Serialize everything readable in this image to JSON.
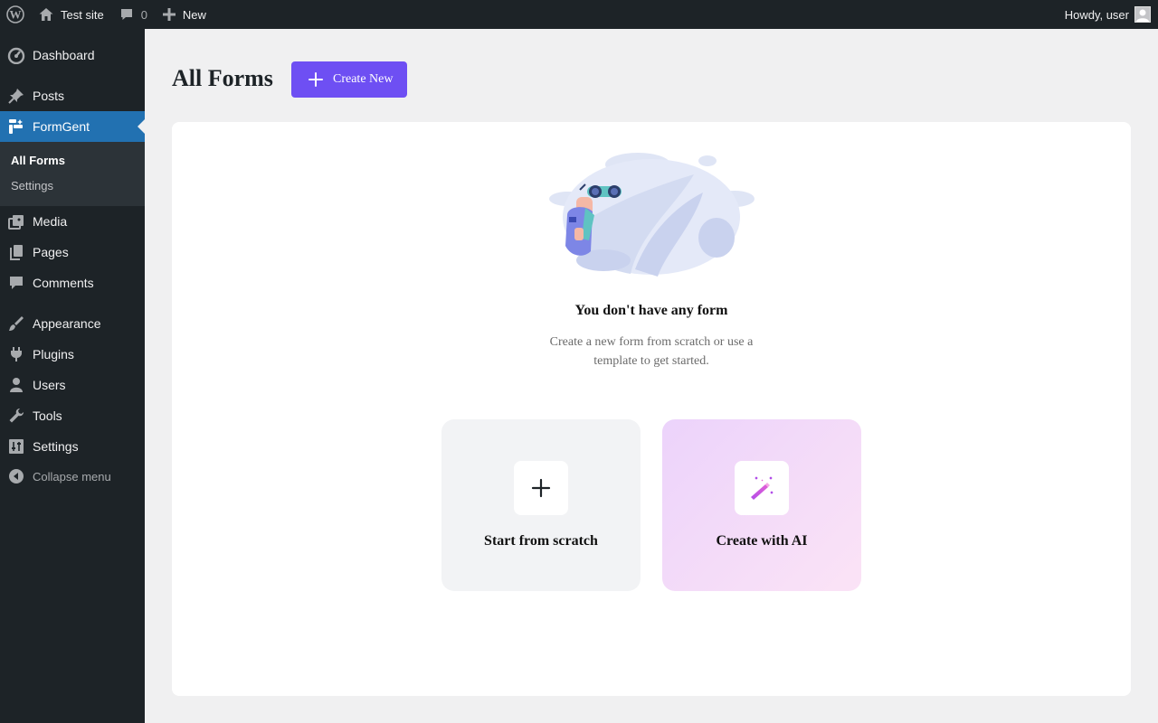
{
  "adminbar": {
    "site_name": "Test site",
    "comments_count": "0",
    "new_label": "New",
    "greeting": "Howdy, user"
  },
  "sidebar": {
    "items": [
      {
        "label": "Dashboard",
        "icon": "dashboard-icon"
      },
      {
        "label": "Posts",
        "icon": "pin-icon"
      },
      {
        "label": "FormGent",
        "icon": "formgent-icon"
      },
      {
        "label": "Media",
        "icon": "media-icon"
      },
      {
        "label": "Pages",
        "icon": "pages-icon"
      },
      {
        "label": "Comments",
        "icon": "comment-icon"
      },
      {
        "label": "Appearance",
        "icon": "brush-icon"
      },
      {
        "label": "Plugins",
        "icon": "plug-icon"
      },
      {
        "label": "Users",
        "icon": "user-icon"
      },
      {
        "label": "Tools",
        "icon": "wrench-icon"
      },
      {
        "label": "Settings",
        "icon": "sliders-icon"
      }
    ],
    "submenu": [
      "All Forms",
      "Settings"
    ],
    "collapse_label": "Collapse menu"
  },
  "main": {
    "title": "All Forms",
    "create_button": "Create New",
    "empty_title": "You don't have any form",
    "empty_desc": "Create a new form from scratch or use a template to get started.",
    "options": [
      {
        "label": "Start from scratch",
        "icon": "plus-icon"
      },
      {
        "label": "Create with AI",
        "icon": "magic-wand-icon"
      }
    ]
  },
  "colors": {
    "accent": "#6e4ff3",
    "wp_blue": "#2271b1",
    "sidebar_bg": "#1d2327"
  }
}
